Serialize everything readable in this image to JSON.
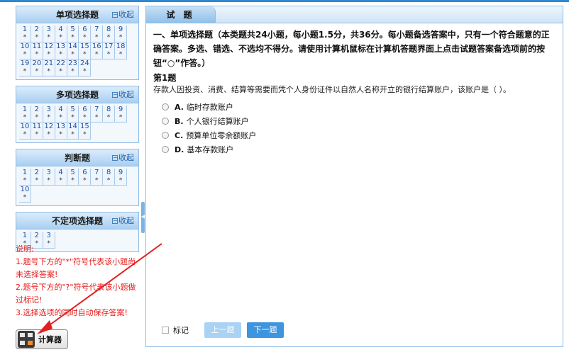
{
  "colors": {
    "accent": "#2f88d0",
    "note_red": "#e81a1a",
    "arrow_red": "#e02020"
  },
  "sidebar": {
    "collapse_label": "收起",
    "unanswered_mark": "*",
    "sections": [
      {
        "title": "单项选择题",
        "numbers": [
          "1",
          "2",
          "3",
          "4",
          "5",
          "6",
          "7",
          "8",
          "9",
          "10",
          "11",
          "12",
          "13",
          "14",
          "15",
          "16",
          "17",
          "18",
          "19",
          "20",
          "21",
          "22",
          "23",
          "24"
        ]
      },
      {
        "title": "多项选择题",
        "numbers": [
          "1",
          "2",
          "3",
          "4",
          "5",
          "6",
          "7",
          "8",
          "9",
          "10",
          "11",
          "12",
          "13",
          "14",
          "15"
        ]
      },
      {
        "title": "判断题",
        "numbers": [
          "1",
          "2",
          "3",
          "4",
          "5",
          "6",
          "7",
          "8",
          "9",
          "10"
        ]
      },
      {
        "title": "不定项选择题",
        "numbers": [
          "1",
          "2",
          "3"
        ]
      }
    ]
  },
  "notes": {
    "title": "说明:",
    "line1": "1.题号下方的\"*\"符号代表该小题尚未选择答案!",
    "line2": "2.题号下方的\"?\"符号代表该小题做过标记!",
    "line3": "3.选择选项的同时自动保存答案!"
  },
  "calculator": {
    "label": "计算器",
    "icon": "calculator-icon"
  },
  "main": {
    "tab_label": "试 题",
    "instruction": "一、单项选择题（本类题共24小题，每小题1.5分，共36分。每小题备选答案中，只有一个符合题意的正确答案。多选、错选、不选均不得分。请使用计算机鼠标在计算机答题界面上点击试题答案备选项前的按钮“○”作答。）",
    "question_no": "第1题",
    "question_text": "存款人因投资、消费、结算等需要而凭个人身份证件以自然人名称开立的银行结算账户，该账户是（    ）。",
    "options": [
      {
        "letter": "A.",
        "text": "临时存款账户"
      },
      {
        "letter": "B.",
        "text": "个人银行结算账户"
      },
      {
        "letter": "C.",
        "text": "预算单位零余额账户"
      },
      {
        "letter": "D.",
        "text": "基本存款账户"
      }
    ],
    "mark_label": "标记",
    "prev_label": "上一题",
    "next_label": "下一题"
  }
}
